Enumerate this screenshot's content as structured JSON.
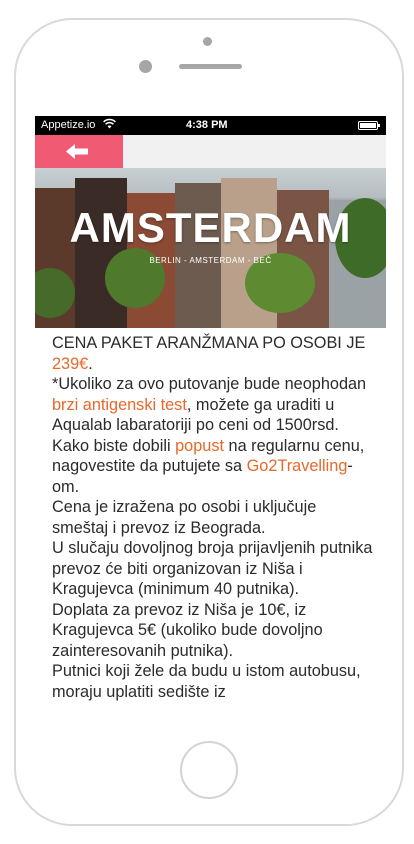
{
  "status_bar": {
    "carrier": "Appetize.io",
    "time": "4:38 PM"
  },
  "navbar": {
    "back_icon": "arrow-left-icon"
  },
  "hero": {
    "title": "AMSTERDAM",
    "subtitle": "BERLIN - AMSTERDAM - BEČ"
  },
  "colors": {
    "accent": "#f05a72",
    "highlight": "#e8682a"
  },
  "content": {
    "p1": {
      "a": "CENA PAKET ARANŽMANA PO OSOBI JE ",
      "price": "239€",
      "b": "."
    },
    "p2": {
      "a": "*Ukoliko za ovo putovanje bude neophodan ",
      "test": "brzi antigenski test",
      "b": ", možete ga uraditi u Aqualab labaratoriji po ceni od 1500rsd. Kako biste dobili ",
      "popust": "popust",
      "c": " na regularnu cenu, nagovestite da putujete sa ",
      "brand": "Go2Travelling",
      "d": "-om."
    },
    "p3": "Cena je izražena po osobi i uključuje smeštaj i prevoz iz Beograda.",
    "p4": "U slučaju dovoljnog broja prijavljenih putnika prevoz će biti organizovan iz Niša i Kragujevca (minimum 40 putnika).",
    "p5": "Doplata za prevoz iz Niša je 10€, iz Kragujevca 5€ (ukoliko bude dovoljno zainteresovanih putnika).",
    "p6": "Putnici koji žele da budu u istom autobusu, moraju uplatiti sedište iz"
  }
}
